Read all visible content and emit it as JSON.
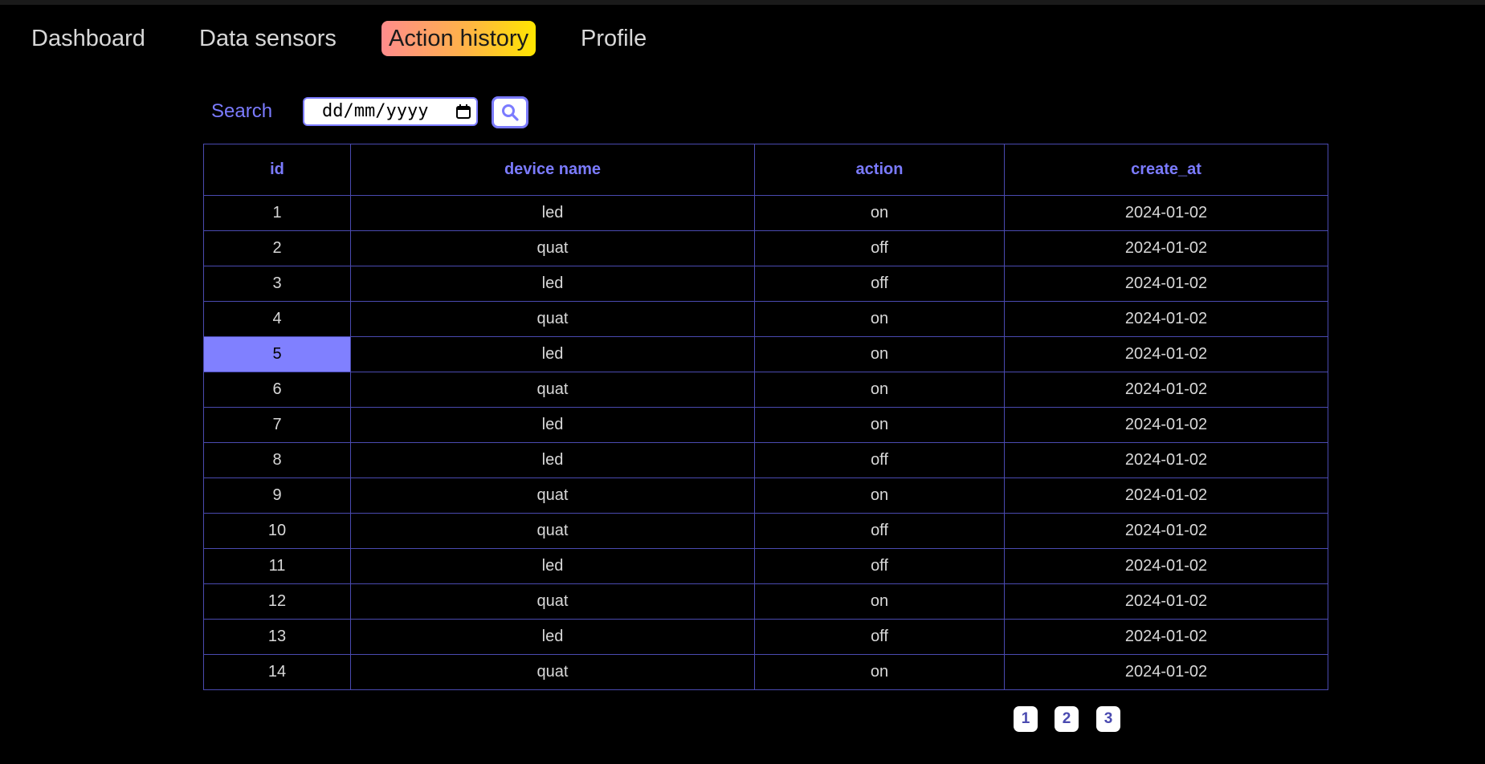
{
  "nav": {
    "items": [
      {
        "label": "Dashboard"
      },
      {
        "label": "Data sensors"
      },
      {
        "label": "Action history"
      },
      {
        "label": "Profile"
      }
    ],
    "active": "Action history"
  },
  "search": {
    "label": "Search",
    "date_placeholder": "dd/mm/yyyy",
    "button_icon": "search-icon",
    "calendar_icon": "calendar-icon"
  },
  "table": {
    "headers": [
      "id",
      "device name",
      "action",
      "create_at"
    ],
    "rows": [
      [
        "1",
        "led",
        "on",
        "2024-01-02"
      ],
      [
        "2",
        "quat",
        "off",
        "2024-01-02"
      ],
      [
        "3",
        "led",
        "off",
        "2024-01-02"
      ],
      [
        "4",
        "quat",
        "on",
        "2024-01-02"
      ],
      [
        "5",
        "led",
        "on",
        "2024-01-02"
      ],
      [
        "6",
        "quat",
        "on",
        "2024-01-02"
      ],
      [
        "7",
        "led",
        "on",
        "2024-01-02"
      ],
      [
        "8",
        "led",
        "off",
        "2024-01-02"
      ],
      [
        "9",
        "quat",
        "on",
        "2024-01-02"
      ],
      [
        "10",
        "quat",
        "off",
        "2024-01-02"
      ],
      [
        "11",
        "led",
        "off",
        "2024-01-02"
      ],
      [
        "12",
        "quat",
        "on",
        "2024-01-02"
      ],
      [
        "13",
        "led",
        "off",
        "2024-01-02"
      ],
      [
        "14",
        "quat",
        "on",
        "2024-01-02"
      ]
    ],
    "selected_cell": {
      "row": 4,
      "col": 0
    }
  },
  "pagination": {
    "pages": [
      "1",
      "2",
      "3"
    ]
  },
  "colors": {
    "accent": "#7b7bff",
    "border": "#4a4ab0",
    "selected": "#8080ff",
    "background": "#000000",
    "active_tab_gradient": [
      "#ff8c8c",
      "#ffb347",
      "#ffe600"
    ]
  }
}
